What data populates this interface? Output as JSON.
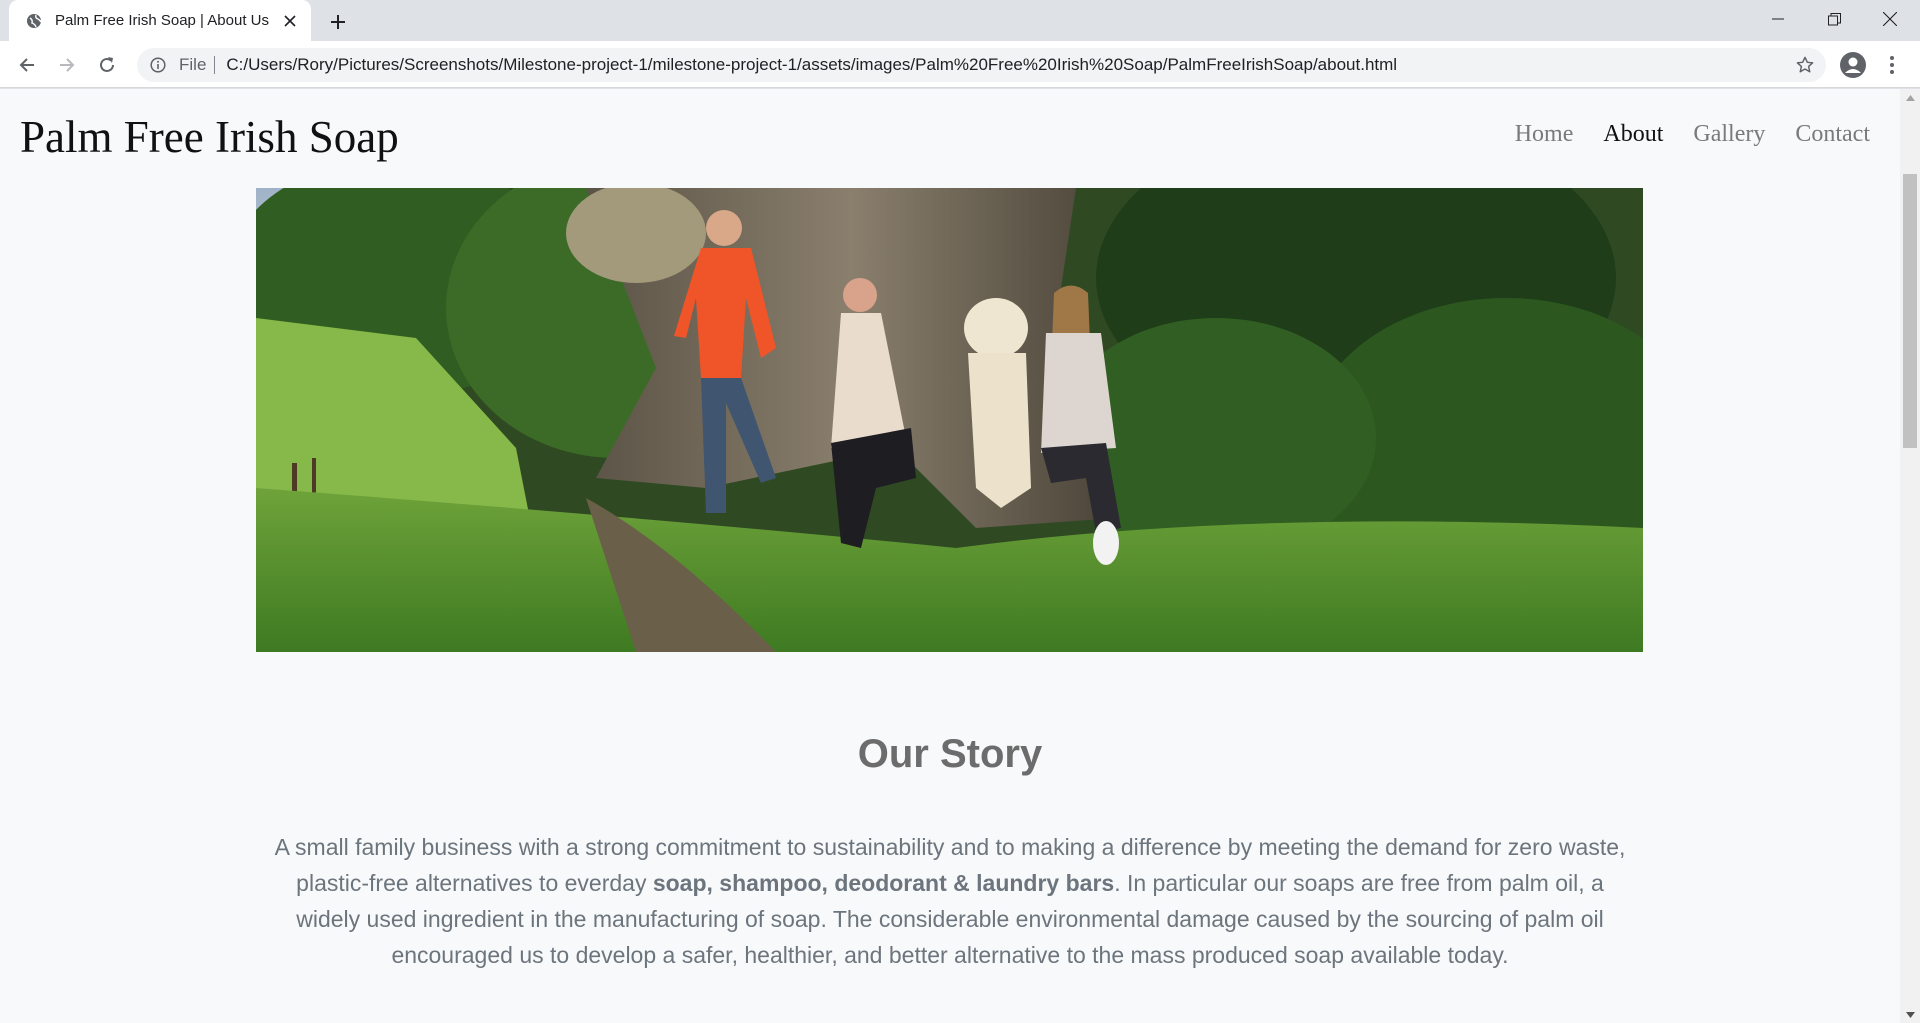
{
  "browser": {
    "tab_title": "Palm Free Irish Soap | About Us",
    "omnibox_scheme": "File",
    "url": "C:/Users/Rory/Pictures/Screenshots/Milestone-project-1/milestone-project-1/assets/images/Palm%20Free%20Irish%20Soap/PalmFreeIrishSoap/about.html"
  },
  "site": {
    "brand": "Palm Free Irish Soap",
    "nav": [
      {
        "label": "Home",
        "active": false
      },
      {
        "label": "About",
        "active": true
      },
      {
        "label": "Gallery",
        "active": false
      },
      {
        "label": "Contact",
        "active": false
      }
    ]
  },
  "story": {
    "heading": "Our Story",
    "text_before": "A small family business with a strong commitment to sustainability and to making a difference by meeting the demand for zero waste, plastic-free alternatives to everday ",
    "text_bold": "soap, shampoo, deodorant & laundry bars",
    "text_after": ". In particular our soaps are free from palm oil, a widely used ingredient in the manufacturing of soap. The considerable environmental damage caused by the sourcing of palm oil encouraged us to develop a safer, healthier, and better alternative to the mass produced soap available today."
  },
  "icons": {
    "favicon": "globe-icon",
    "tab_close": "close-icon",
    "new_tab": "plus-icon",
    "back": "back-arrow-icon",
    "forward": "forward-arrow-icon",
    "reload": "reload-icon",
    "info": "info-icon",
    "bookmark": "star-icon",
    "profile": "profile-icon",
    "menu": "kebab-menu-icon"
  },
  "colors": {
    "page_bg": "#f8f9fa",
    "nav_inactive": "#7a7a7a",
    "nav_active": "#111111",
    "body_text": "#6c757d"
  }
}
